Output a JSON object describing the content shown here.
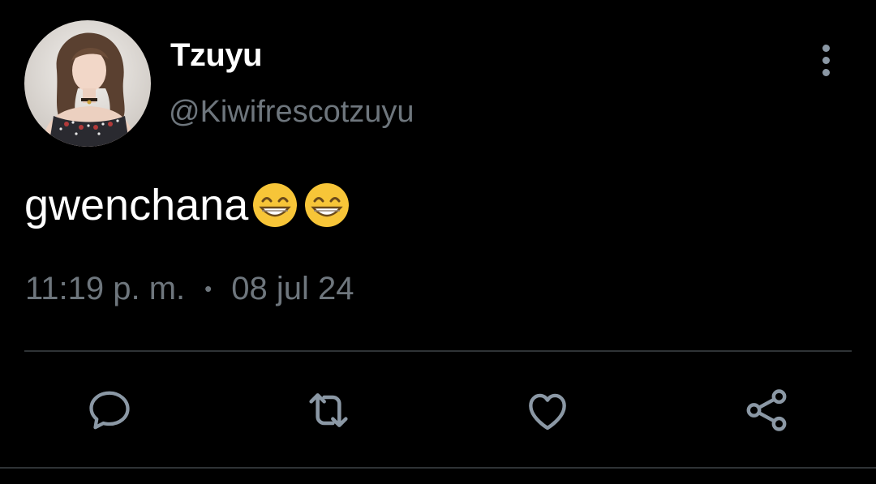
{
  "user": {
    "display_name": "Tzuyu",
    "handle": "@Kiwifrescotzuyu",
    "avatar": "avatar-photo"
  },
  "tweet": {
    "text": "gwenchana",
    "emojis": [
      "grinning-face-with-smiling-eyes",
      "grinning-face-with-smiling-eyes"
    ]
  },
  "meta": {
    "time": "11:19 p. m.",
    "separator": "•",
    "date": "08 jul 24"
  },
  "actions": [
    {
      "icon": "reply-icon"
    },
    {
      "icon": "retweet-icon"
    },
    {
      "icon": "like-icon"
    },
    {
      "icon": "share-icon"
    }
  ],
  "colors": {
    "background": "#000000",
    "primary_text": "#ffffff",
    "secondary_text": "#6e767d",
    "icon": "#8b98a5",
    "divider": "#2f3336"
  }
}
